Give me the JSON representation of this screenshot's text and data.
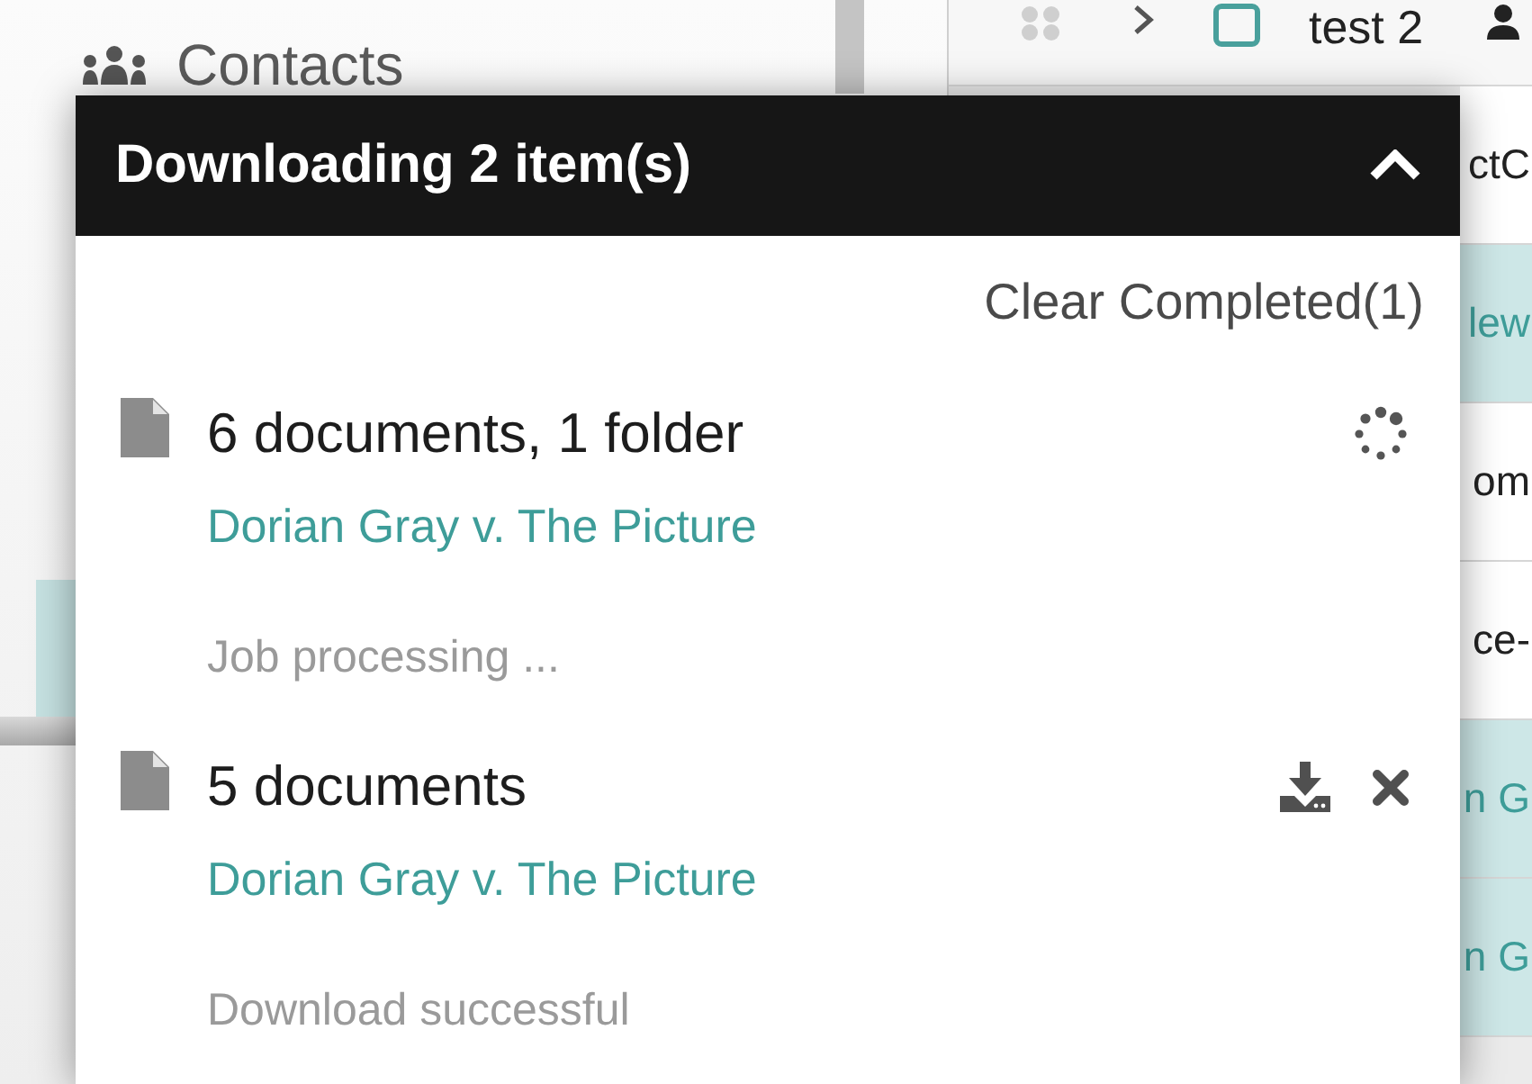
{
  "sidebar": {
    "items": [
      {
        "label": "Contacts",
        "selected": false
      },
      {
        "selected": true
      }
    ]
  },
  "list": {
    "header": {
      "title": "test 2"
    },
    "rows": [
      {
        "text": "ctC",
        "selected": false
      },
      {
        "text": "lew",
        "selected": true
      },
      {
        "text": "om",
        "selected": false
      },
      {
        "text": "ce-",
        "selected": false
      },
      {
        "text": "n G",
        "selected": true
      },
      {
        "text": "n G",
        "selected": true
      }
    ]
  },
  "download_panel": {
    "title": "Downloading 2 item(s)",
    "expanded": true,
    "clear_button": "Clear Completed(1)",
    "items": [
      {
        "kind": "processing",
        "title": "6 documents, 1 folder",
        "link": "Dorian Gray v. The Picture",
        "status": "Job processing ..."
      },
      {
        "kind": "completed",
        "title": "5 documents",
        "link": "Dorian Gray v. The Picture",
        "status": "Download successful"
      }
    ]
  }
}
